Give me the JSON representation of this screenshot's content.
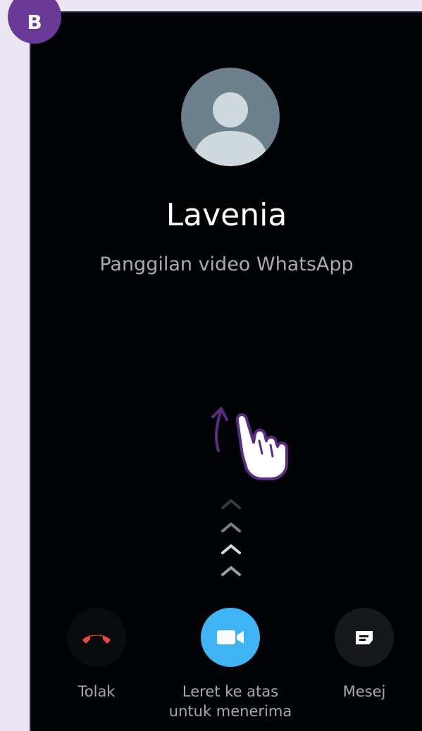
{
  "step_badge": "B",
  "caller": {
    "name": "Lavenia",
    "call_type": "Panggilan video WhatsApp"
  },
  "gesture": {
    "hand_icon": "pointing-hand-swipe-up-icon",
    "arrow_icon": "arrow-up-icon",
    "chevron_icon": "chevron-up-icon",
    "chevron_count": 4
  },
  "actions": {
    "decline": {
      "label": "Tolak",
      "icon": "phone-hangup-icon",
      "color": "#f0453a"
    },
    "accept": {
      "label_line1": "Leret ke atas",
      "label_line2": "untuk menerima",
      "icon": "video-camera-icon",
      "color": "#3fb4f4"
    },
    "message": {
      "label": "Mesej",
      "icon": "message-icon"
    }
  },
  "colors": {
    "badge": "#6a3a96",
    "annotation": "#5b2c84",
    "background": "#010204"
  }
}
